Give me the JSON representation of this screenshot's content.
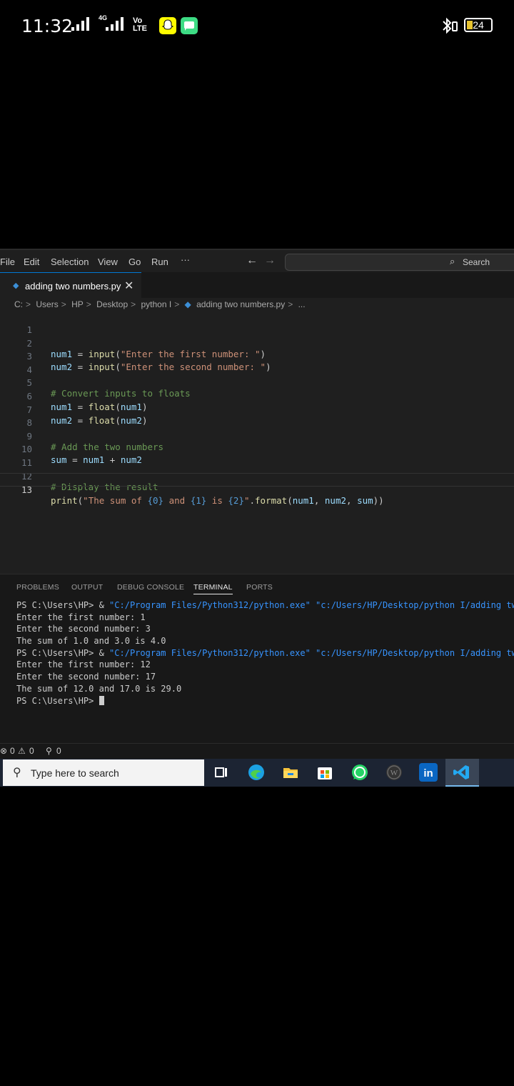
{
  "status_bar": {
    "time": "11:32",
    "network": "4G",
    "volte": "Vo LTE",
    "battery": "24",
    "icons": [
      "signal-icon",
      "signal-4g-icon",
      "volte-icon",
      "snapchat-icon",
      "messages-icon",
      "bluetooth-icon",
      "battery-icon"
    ]
  },
  "menu": [
    "File",
    "Edit",
    "Selection",
    "View",
    "Go",
    "Run",
    "···"
  ],
  "command_center": {
    "search_label": "Search"
  },
  "tab": {
    "filename": "adding two numbers.py"
  },
  "breadcrumbs": [
    "C:",
    "Users",
    "HP",
    "Desktop",
    "python I",
    "adding two numbers.py",
    "..."
  ],
  "editor": {
    "active_line": 13,
    "lines": [
      {
        "n": "1",
        "text": ""
      },
      {
        "n": "2",
        "text": "num1 = input(\"Enter the first number: \")"
      },
      {
        "n": "3",
        "text": "num2 = input(\"Enter the second number: \")"
      },
      {
        "n": "4",
        "text": ""
      },
      {
        "n": "5",
        "text": "# Convert inputs to floats"
      },
      {
        "n": "6",
        "text": "num1 = float(num1)"
      },
      {
        "n": "7",
        "text": "num2 = float(num2)"
      },
      {
        "n": "8",
        "text": ""
      },
      {
        "n": "9",
        "text": "# Add the two numbers"
      },
      {
        "n": "10",
        "text": "sum = num1 + num2"
      },
      {
        "n": "11",
        "text": ""
      },
      {
        "n": "12",
        "text": "# Display the result"
      },
      {
        "n": "13",
        "text": "print(\"The sum of {0} and {1} is {2}\".format(num1, num2, sum))"
      }
    ]
  },
  "panel": {
    "tabs": [
      "PROBLEMS",
      "OUTPUT",
      "DEBUG CONSOLE",
      "TERMINAL",
      "PORTS"
    ],
    "active_tab": "TERMINAL",
    "terminal_lines": [
      {
        "prompt": "PS C:\\Users\\HP> ",
        "cmd": "& ",
        "path": "\"C:/Program Files/Python312/python.exe\"",
        "arg": " \"c:/Users/HP/Desktop/python I/adding two num"
      },
      {
        "text": "Enter the first number: 1"
      },
      {
        "text": "Enter the second number: 3"
      },
      {
        "text": "The sum of 1.0 and 3.0 is 4.0"
      },
      {
        "prompt": "PS C:\\Users\\HP> ",
        "cmd": "& ",
        "path": "\"C:/Program Files/Python312/python.exe\"",
        "arg": " \"c:/Users/HP/Desktop/python I/adding two num"
      },
      {
        "text": "Enter the first number: 12"
      },
      {
        "text": "Enter the second number: 17"
      },
      {
        "text": "The sum of 12.0 and 17.0 is 29.0"
      },
      {
        "prompt": "PS C:\\Users\\HP> ",
        "cursor": true
      }
    ]
  },
  "vscode_status": {
    "errors": "0",
    "warnings": "0",
    "ports": "0"
  },
  "taskbar": {
    "search_placeholder": "Type here to search",
    "apps": [
      "task-view-icon",
      "edge-icon",
      "file-explorer-icon",
      "store-icon",
      "whatsapp-icon",
      "wordpress-icon",
      "linkedin-icon",
      "vscode-icon"
    ]
  }
}
